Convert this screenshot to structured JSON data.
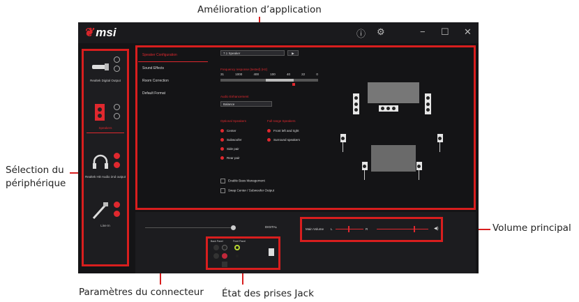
{
  "callouts": {
    "app_enhancement": "Amélioration d’application",
    "device_selection_1": "Sélection du",
    "device_selection_2": "périphérique",
    "master_volume": "Volume principal",
    "connector_settings": "Paramètres du connecteur",
    "jack_status": "État des prises Jack"
  },
  "app": {
    "logo": "msi",
    "icons": [
      "info-icon",
      "gear-icon",
      "minimize-icon",
      "maximize-icon",
      "close-icon"
    ],
    "devices": [
      {
        "label": "Realtek Digital Output",
        "icon": "optical-cable-icon"
      },
      {
        "label": "Speakers",
        "icon": "speaker-icon"
      },
      {
        "label": "Realtek HD Audio 2nd output",
        "icon": "headphones-icon"
      },
      {
        "label": "Line In",
        "icon": "line-in-cable-icon"
      }
    ],
    "menu": [
      "Speaker Configuration",
      "Sound Effects",
      "Room Correction",
      "Default Format"
    ],
    "speaker_select": "7.1 Speaker",
    "play_button": "▶",
    "eq_title": "Frequency response (tested) (Hz)",
    "eq_ticks": [
      "31",
      "1000",
      "400",
      "100",
      "40",
      "22",
      "0"
    ],
    "balance_title": "Audio Enhancement",
    "balance_select": "Balance",
    "optional_title": "Optional Speakers",
    "fullrange_title": "Full-range Speakers",
    "optional_items": [
      "Center",
      "Subwoofer",
      "Side pair",
      "Rear pair"
    ],
    "fullrange_items": [
      "Front left and right",
      "Surround speakers"
    ],
    "checkbox_items": [
      "Enable Bass Management",
      "Swap Center / Subwoofer Output"
    ],
    "digital_label": "DIGITAL",
    "main_volume_label": "Main Volume",
    "vol_left": "L",
    "vol_right": "R",
    "jack_headers": [
      "Back Panel",
      "Front Panel"
    ]
  },
  "colors": {
    "accent": "#d81e1e",
    "bg": "#141416"
  }
}
